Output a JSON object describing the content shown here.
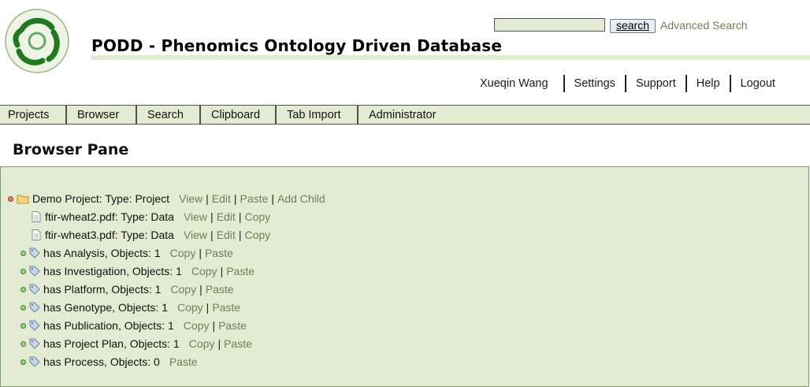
{
  "header": {
    "app_title": "PODD - Phenomics Ontology Driven Database",
    "search": {
      "value": "",
      "button_label": "search",
      "advanced_label": "Advanced Search"
    }
  },
  "user_nav": {
    "items": [
      {
        "label": "Xueqin Wang"
      },
      {
        "label": "Settings"
      },
      {
        "label": "Support"
      },
      {
        "label": "Help"
      },
      {
        "label": "Logout"
      }
    ]
  },
  "main_nav": {
    "tabs": [
      {
        "label": "Projects"
      },
      {
        "label": "Browser"
      },
      {
        "label": "Search"
      },
      {
        "label": "Clipboard"
      },
      {
        "label": "Tab Import"
      },
      {
        "label": "Administrator"
      }
    ]
  },
  "pane": {
    "title": "Browser Pane",
    "tree": {
      "root": {
        "label": "Demo Project: Type: Project",
        "actions": [
          "View",
          "Edit",
          "Paste",
          "Add Child"
        ]
      },
      "files": [
        {
          "label": "ftir-wheat2.pdf: Type: Data",
          "actions": [
            "View",
            "Edit",
            "Copy"
          ]
        },
        {
          "label": "ftir-wheat3.pdf: Type: Data",
          "actions": [
            "View",
            "Edit",
            "Copy"
          ]
        }
      ],
      "relations": [
        {
          "label": "has Analysis, Objects: 1",
          "actions": [
            "Copy",
            "Paste"
          ]
        },
        {
          "label": "has Investigation, Objects: 1",
          "actions": [
            "Copy",
            "Paste"
          ]
        },
        {
          "label": "has Platform, Objects: 1",
          "actions": [
            "Copy",
            "Paste"
          ]
        },
        {
          "label": "has Genotype, Objects: 1",
          "actions": [
            "Copy",
            "Paste"
          ]
        },
        {
          "label": "has Publication, Objects: 1",
          "actions": [
            "Copy",
            "Paste"
          ]
        },
        {
          "label": "has Project Plan, Objects: 1",
          "actions": [
            "Copy",
            "Paste"
          ]
        },
        {
          "label": "has Process, Objects: 0",
          "actions": [
            "Paste"
          ]
        }
      ]
    }
  },
  "colors": {
    "accent_green": "#e3ecd3",
    "link_olive": "#707f55",
    "logo_green": "#1f7a1f"
  }
}
